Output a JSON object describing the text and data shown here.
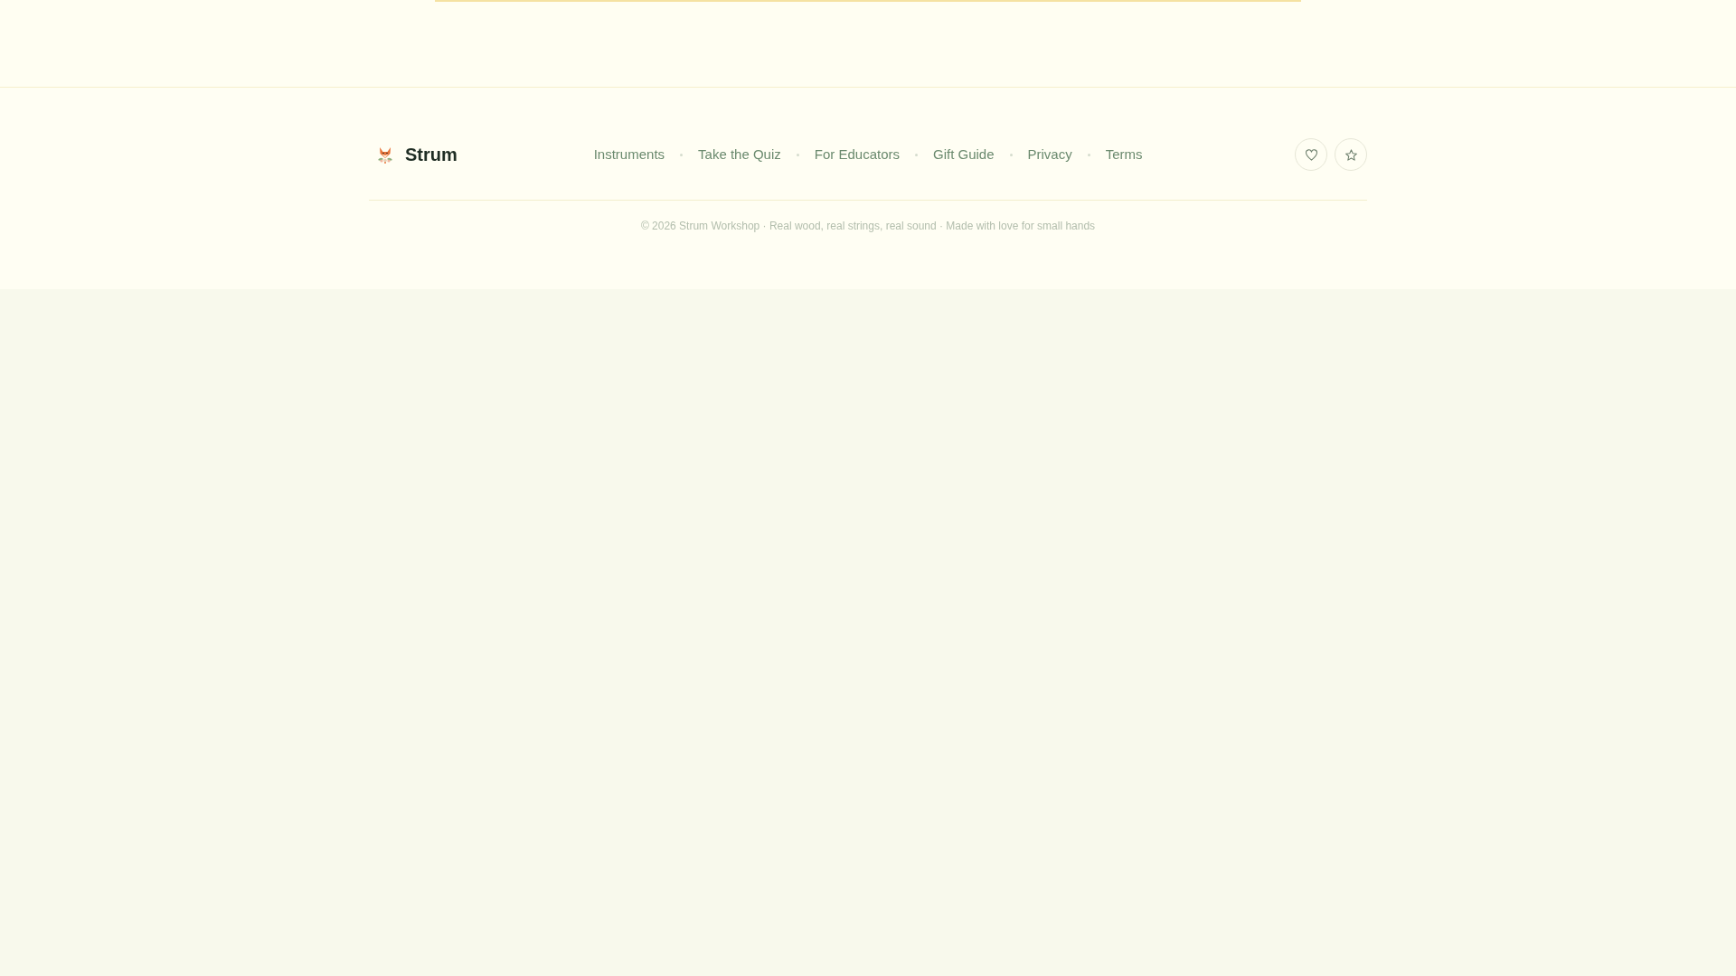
{
  "brand": {
    "name": "Strum"
  },
  "nav_links": [
    {
      "label": "Instruments"
    },
    {
      "label": "Take the Quiz"
    },
    {
      "label": "For Educators"
    },
    {
      "label": "Gift Guide"
    },
    {
      "label": "Privacy"
    },
    {
      "label": "Terms"
    }
  ],
  "icon_buttons": [
    {
      "kind": "heart"
    },
    {
      "kind": "star"
    }
  ],
  "copyright": "© 2026 Strum Workshop · Real wood, real strings, real sound · Made with love for small hands"
}
